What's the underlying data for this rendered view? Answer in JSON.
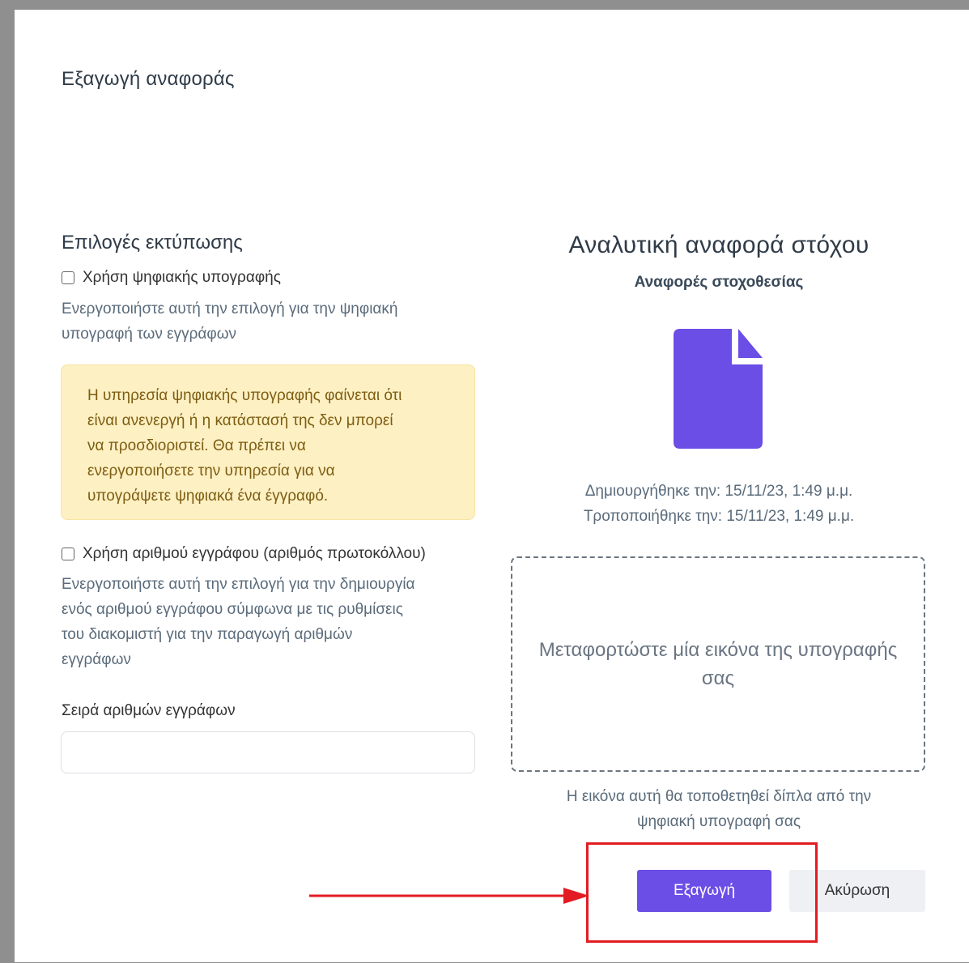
{
  "modal": {
    "title": "Εξαγωγή αναφοράς"
  },
  "print_options": {
    "title": "Επιλογές εκτύπωσης",
    "digital_signature": {
      "label": "Χρήση ψηφιακής υπογραφής",
      "checked": false,
      "help_line1": "Ενεργοποιήστε αυτή την επιλογή για την ψηφιακή",
      "help_line2": "υπογραφή των εγγράφων"
    },
    "alert": {
      "line1": "Η υπηρεσία ψηφιακής υπογραφής φαίνεται ότι",
      "line2": "είναι ανενεργή ή η κατάστασή της δεν μπορεί",
      "line3": "να προσδιοριστεί. Θα πρέπει να",
      "line4": "ενεργοποιήσετε την υπηρεσία για να",
      "line5": "υπογράψετε ψηφιακά ένα έγγραφό."
    },
    "document_number": {
      "label": "Χρήση αριθμού εγγράφου (αριθμός πρωτοκόλλου)",
      "checked": false,
      "help_line1": "Ενεργοποιήστε αυτή την επιλογή για την δημιουργία",
      "help_line2": "ενός αριθμού εγγράφου σύμφωνα με τις ρυθμίσεις",
      "help_line3": "του διακομιστή για την παραγωγή αριθμών",
      "help_line4": "εγγράφων"
    },
    "series": {
      "label": "Σειρά αριθμών εγγράφων",
      "value": "",
      "placeholder": ""
    }
  },
  "report": {
    "title": "Αναλυτική αναφορά στόχου",
    "subtitle": "Αναφορές στοχοθεσίας",
    "icon": "file-icon",
    "icon_color": "#6b4ee6",
    "created": "Δημιουργήθηκε την: 15/11/23, 1:49 μ.μ.",
    "modified": "Τροποποιήθηκε την: 15/11/23, 1:49 μ.μ.",
    "dropzone_line1": "Μεταφορτώστε μία εικόνα της υπογραφής",
    "dropzone_line2": "σας",
    "note_line1": "Η εικόνα αυτή θα τοποθετηθεί δίπλα από την",
    "note_line2": "ψηφιακή υπογραφή σας"
  },
  "actions": {
    "export_label": "Εξαγωγή",
    "cancel_label": "Ακύρωση",
    "primary_color": "#6b4ee6"
  },
  "annotation": {
    "highlight_color": "#e31b23"
  }
}
